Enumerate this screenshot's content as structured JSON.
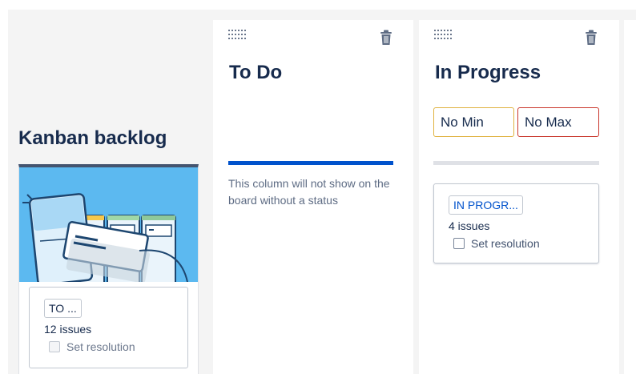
{
  "backlog": {
    "title": "Kanban backlog",
    "status": {
      "lozenge": "TO ...",
      "issues": "12 issues",
      "resolution_label": "Set resolution"
    }
  },
  "columns": [
    {
      "title": "To Do",
      "note": "This column will not show on the board without a status",
      "bar_color": "#0052cc"
    },
    {
      "title": "In Progress",
      "min_label": "No Min",
      "max_label": "No Max",
      "status": {
        "lozenge": "IN PROGR...",
        "issues": "4 issues",
        "resolution_label": "Set resolution"
      }
    }
  ],
  "icons": {
    "drag": "drag-handle-icon",
    "delete": "trash-icon"
  },
  "colors": {
    "heading": "#172b4d",
    "primary": "#0052cc",
    "min_border": "#e0b341",
    "max_border": "#c9372c"
  }
}
